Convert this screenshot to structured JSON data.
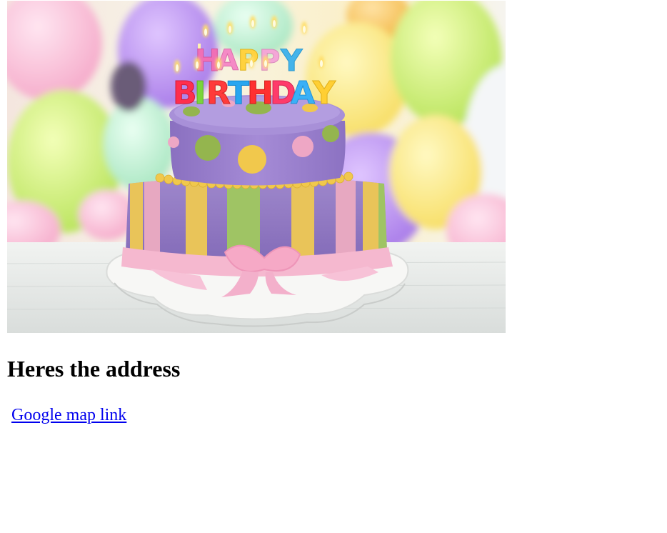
{
  "image": {
    "subject": "birthday-cake-photo",
    "candle_letters_row1": [
      "H",
      "A",
      "P",
      "P",
      "Y"
    ],
    "candle_letters_row2": [
      "B",
      "I",
      "R",
      "T",
      "H",
      "D",
      "A",
      "Y"
    ],
    "candle_colors_row1": [
      "#f06fb6",
      "#f58ac6",
      "#ffd23f",
      "#f4a6d7",
      "#45b4ea"
    ],
    "candle_colors_row2": [
      "#ff2e4d",
      "#7ad53a",
      "#ff3b3b",
      "#28a6f0",
      "#ff3030",
      "#ff3b6a",
      "#3ab0f7",
      "#ffcf33"
    ],
    "colors": {
      "cake_purple": "#9f86cf",
      "cake_pink": "#f4b2cc",
      "stripe_green": "#a8cf6a",
      "stripe_yellow": "#f6cf5e",
      "dot_green": "#94b54e",
      "dot_yellow": "#f1c84c",
      "dot_pink": "#eea7c5",
      "table": "#e9ecea"
    }
  },
  "content": {
    "heading": "Heres the address",
    "map_link_text": "Google map link",
    "link_color": "#0000ee"
  }
}
